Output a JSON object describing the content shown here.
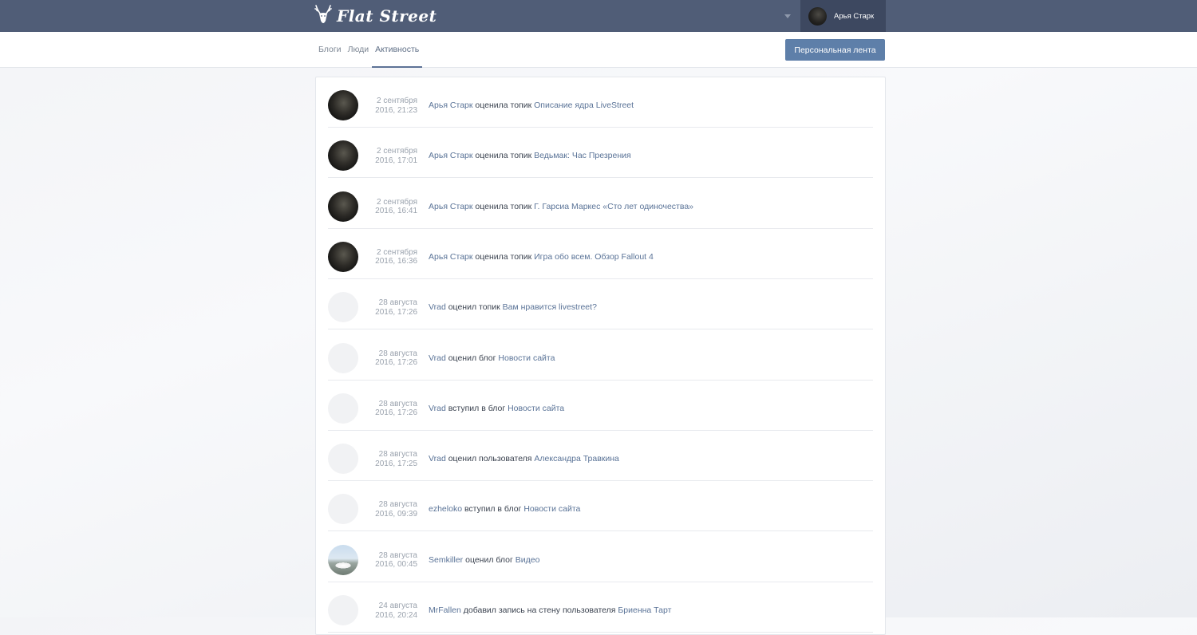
{
  "header": {
    "logo_text": "Flat Street",
    "logo_icon": "deer-head-icon",
    "user_name": "Арья Старк",
    "dropdown_icon": "caret-down-icon"
  },
  "nav": {
    "tabs": [
      {
        "label": "Блоги",
        "active": false
      },
      {
        "label": "Люди",
        "active": false
      },
      {
        "label": "Активность",
        "active": true
      }
    ],
    "feed_button": "Персональная лента"
  },
  "colors": {
    "topbar": "#505d77",
    "user_box": "#3d4860",
    "accent": "#5e7fa9",
    "link": "#5a7397"
  },
  "activity": [
    {
      "avatar": "dark",
      "date_line1": "2 сентября",
      "date_line2": "2016, 21:23",
      "user": "Арья Старк",
      "action": "оценила топик",
      "target": "Описание ядра LiveStreet"
    },
    {
      "avatar": "dark",
      "date_line1": "2 сентября",
      "date_line2": "2016, 17:01",
      "user": "Арья Старк",
      "action": "оценила топик",
      "target": "Ведьмак: Час Презрения"
    },
    {
      "avatar": "dark",
      "date_line1": "2 сентября",
      "date_line2": "2016, 16:41",
      "user": "Арья Старк",
      "action": "оценила топик",
      "target": "Г. Гарсиа Маркес «Сто лет одиночества»"
    },
    {
      "avatar": "dark",
      "date_line1": "2 сентября",
      "date_line2": "2016, 16:36",
      "user": "Арья Старк",
      "action": "оценила топик",
      "target": "Игра обо всем. Обзор Fallout 4"
    },
    {
      "avatar": "empty",
      "date_line1": "28 августа",
      "date_line2": "2016, 17:26",
      "user": "Vrad",
      "action": "оценил топик",
      "target": "Вам нравится livestreet?"
    },
    {
      "avatar": "empty",
      "date_line1": "28 августа",
      "date_line2": "2016, 17:26",
      "user": "Vrad",
      "action": "оценил блог",
      "target": "Новости сайта"
    },
    {
      "avatar": "empty",
      "date_line1": "28 августа",
      "date_line2": "2016, 17:26",
      "user": "Vrad",
      "action": "вступил в блог",
      "target": "Новости сайта"
    },
    {
      "avatar": "empty",
      "date_line1": "28 августа",
      "date_line2": "2016, 17:25",
      "user": "Vrad",
      "action": "оценил пользователя",
      "target": "Александра Травкина"
    },
    {
      "avatar": "empty",
      "date_line1": "28 августа",
      "date_line2": "2016, 09:39",
      "user": "ezheloko",
      "action": "вступил в блог",
      "target": "Новости сайта"
    },
    {
      "avatar": "car",
      "date_line1": "28 августа",
      "date_line2": "2016, 00:45",
      "user": "Semkiller",
      "action": "оценил блог",
      "target": "Видео"
    },
    {
      "avatar": "empty",
      "date_line1": "24 августа",
      "date_line2": "2016, 20:24",
      "user": "MrFallen",
      "action": "добавил запись на стену пользователя",
      "target": "Бриенна Тарт"
    }
  ]
}
